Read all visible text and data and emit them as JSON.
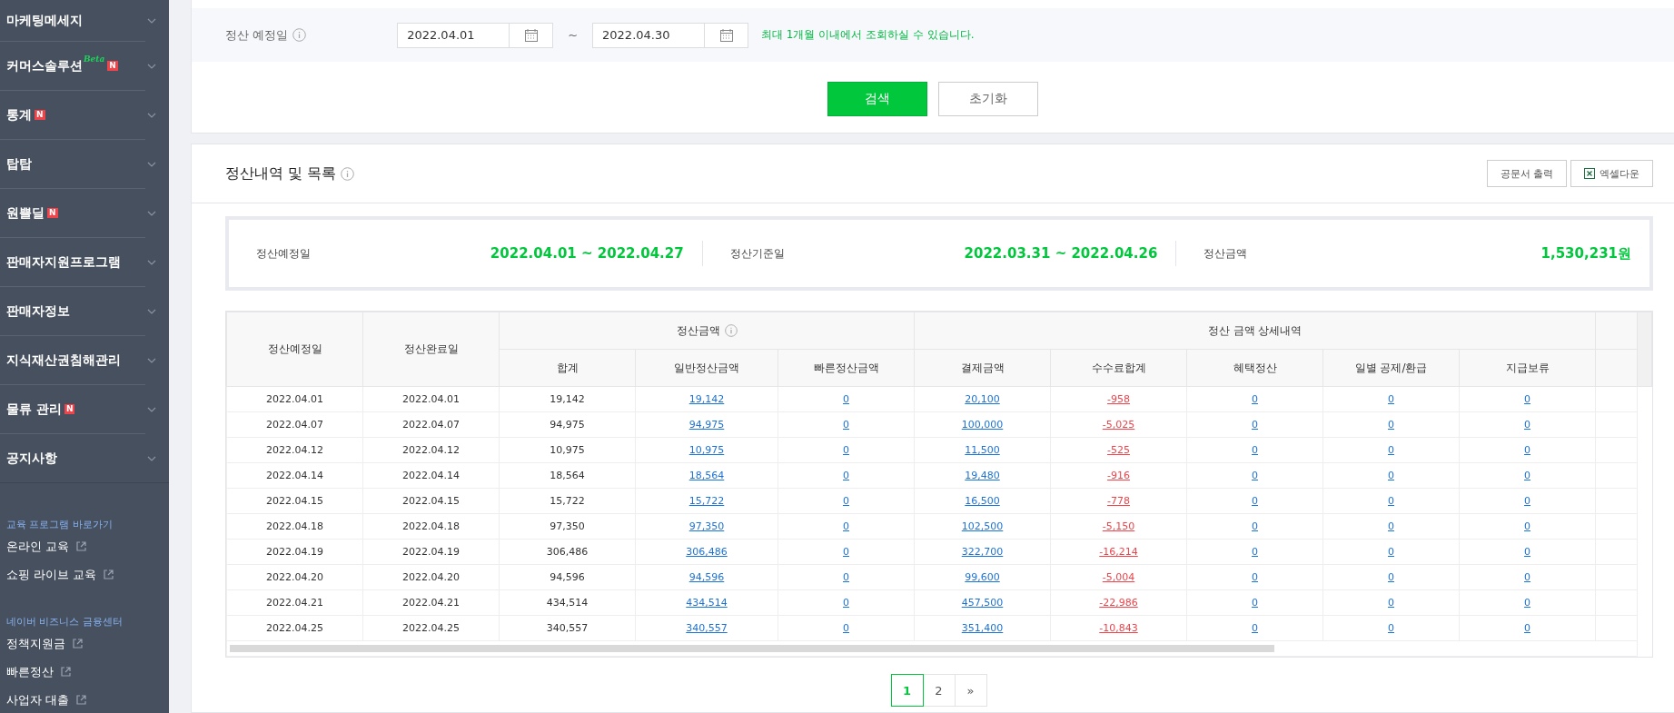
{
  "sidebar": {
    "menu": [
      {
        "label": "마케팅메세지"
      },
      {
        "label": "커머스솔루션",
        "badges": [
          {
            "kind": "beta",
            "text": "Beta"
          },
          {
            "kind": "new",
            "text": "N"
          }
        ]
      },
      {
        "label": "통계",
        "badges": [
          {
            "kind": "new",
            "text": "N"
          }
        ]
      },
      {
        "label": "탑탑"
      },
      {
        "label": "원쁠딜",
        "badges": [
          {
            "kind": "new",
            "text": "N"
          }
        ]
      },
      {
        "label": "판매자지원프로그램"
      },
      {
        "label": "판매자정보"
      },
      {
        "label": "지식재산권침해관리"
      },
      {
        "label": "물류 관리",
        "badges": [
          {
            "kind": "new",
            "text": "N"
          }
        ]
      },
      {
        "label": "공지사항"
      }
    ],
    "sections": [
      {
        "heading": "교육 프로그램 바로가기",
        "links": [
          "온라인 교육",
          "쇼핑 라이브 교육"
        ]
      },
      {
        "heading": "네이버 비즈니스 금융센터",
        "links": [
          "정책지원금",
          "빠른정산",
          "사업자 대출"
        ]
      }
    ]
  },
  "filter": {
    "label": "정산 예정일",
    "start": "2022.04.01",
    "separator": "~",
    "end": "2022.04.30",
    "hint": "최대 1개월 이내에서 조회하실 수 있습니다.",
    "buttons": [
      {
        "label": "검색",
        "kind": "primary"
      },
      {
        "label": "초기화",
        "kind": "secondary"
      }
    ]
  },
  "list": {
    "title": "정산내역 및 목록",
    "actions": [
      {
        "label": "공문서 출력",
        "kind": "plain"
      },
      {
        "label": "엑셀다운",
        "kind": "excel"
      }
    ],
    "summary": [
      {
        "label": "정산예정일",
        "value": "2022.04.01 ~ 2022.04.27"
      },
      {
        "label": "정산기준일",
        "value": "2022.03.31 ~ 2022.04.26"
      },
      {
        "label": "정산금액",
        "value": "1,530,231원"
      }
    ],
    "table": {
      "fixed_columns": [
        "정산예정일",
        "정산완료일"
      ],
      "groups": [
        {
          "label": "정산금액",
          "info": true,
          "columns": [
            {
              "label": "합계",
              "kind": "plain"
            },
            {
              "label": "일반정산금액",
              "kind": "link"
            },
            {
              "label": "빠른정산금액",
              "kind": "link"
            }
          ]
        },
        {
          "label": "정산 금액 상세내역",
          "columns": [
            {
              "label": "결제금액",
              "kind": "link"
            },
            {
              "label": "수수료합계",
              "kind": "negative"
            },
            {
              "label": "혜택정산",
              "kind": "link"
            },
            {
              "label": "일별 공제/환급",
              "kind": "link"
            },
            {
              "label": "지급보류",
              "kind": "link"
            }
          ]
        }
      ],
      "rows": [
        [
          "2022.04.01",
          "2022.04.01",
          "19,142",
          "19,142",
          "0",
          "20,100",
          "-958",
          "0",
          "0",
          "0"
        ],
        [
          "2022.04.07",
          "2022.04.07",
          "94,975",
          "94,975",
          "0",
          "100,000",
          "-5,025",
          "0",
          "0",
          "0"
        ],
        [
          "2022.04.12",
          "2022.04.12",
          "10,975",
          "10,975",
          "0",
          "11,500",
          "-525",
          "0",
          "0",
          "0"
        ],
        [
          "2022.04.14",
          "2022.04.14",
          "18,564",
          "18,564",
          "0",
          "19,480",
          "-916",
          "0",
          "0",
          "0"
        ],
        [
          "2022.04.15",
          "2022.04.15",
          "15,722",
          "15,722",
          "0",
          "16,500",
          "-778",
          "0",
          "0",
          "0"
        ],
        [
          "2022.04.18",
          "2022.04.18",
          "97,350",
          "97,350",
          "0",
          "102,500",
          "-5,150",
          "0",
          "0",
          "0"
        ],
        [
          "2022.04.19",
          "2022.04.19",
          "306,486",
          "306,486",
          "0",
          "322,700",
          "-16,214",
          "0",
          "0",
          "0"
        ],
        [
          "2022.04.20",
          "2022.04.20",
          "94,596",
          "94,596",
          "0",
          "99,600",
          "-5,004",
          "0",
          "0",
          "0"
        ],
        [
          "2022.04.21",
          "2022.04.21",
          "434,514",
          "434,514",
          "0",
          "457,500",
          "-22,986",
          "0",
          "0",
          "0"
        ],
        [
          "2022.04.25",
          "2022.04.25",
          "340,557",
          "340,557",
          "0",
          "351,400",
          "-10,843",
          "0",
          "0",
          "0"
        ]
      ]
    },
    "pagination": {
      "pages": [
        {
          "label": "1",
          "selected": true
        },
        {
          "label": "2",
          "selected": false
        }
      ],
      "next": "»"
    }
  }
}
